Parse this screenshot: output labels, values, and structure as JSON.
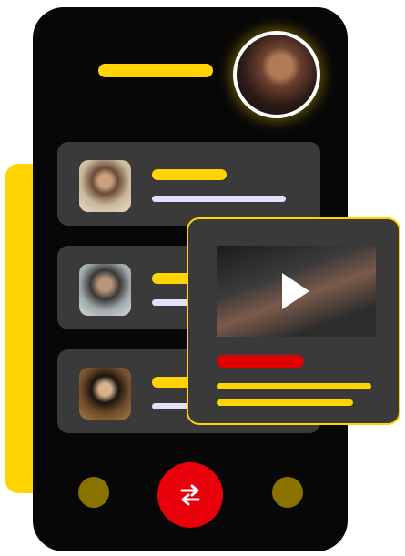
{
  "colors": {
    "accent": "#ffd400",
    "phone_background": "#070707",
    "card_background": "#3a3a3a",
    "line_lavender": "#e6defc",
    "alert_red": "#e00000",
    "dot_olive": "#8a7200",
    "button_red": "#e8000b"
  },
  "header": {
    "avatar": "profile-photo"
  },
  "cards": [
    {
      "avatar": "contact-photo-1"
    },
    {
      "avatar": "contact-photo-2"
    },
    {
      "avatar": "contact-photo-3"
    }
  ],
  "video": {
    "thumbnail": "workout-video-thumbnail",
    "play_icon": "play-icon"
  },
  "bottom_nav": {
    "center_icon": "swap-arrows-icon"
  }
}
